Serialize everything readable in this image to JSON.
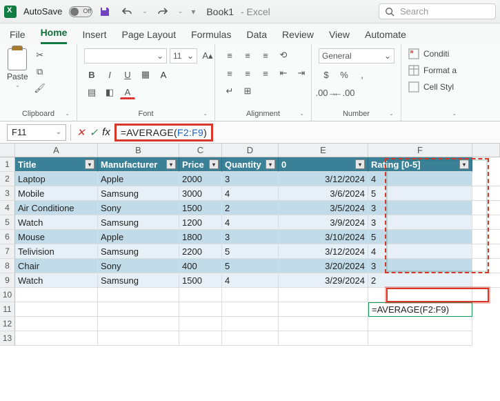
{
  "titlebar": {
    "autosave_label": "AutoSave",
    "autosave_state": "Off",
    "book_name": "Book1",
    "app_name": "Excel",
    "search_placeholder": "Search"
  },
  "tabs": [
    "File",
    "Home",
    "Insert",
    "Page Layout",
    "Formulas",
    "Data",
    "Review",
    "View",
    "Automate"
  ],
  "active_tab": "Home",
  "ribbon": {
    "clipboard": {
      "paste": "Paste",
      "group": "Clipboard"
    },
    "font": {
      "size": "11",
      "group": "Font"
    },
    "alignment": {
      "group": "Alignment"
    },
    "number": {
      "format": "General",
      "group": "Number"
    },
    "styles": {
      "cond": "Conditi",
      "fmt": "Format a",
      "cell": "Cell Styl"
    }
  },
  "namebox": "F11",
  "formula": {
    "prefix": "=AVERAGE(",
    "ref": "F2:F9",
    "suffix": ")"
  },
  "columns_letters": [
    "A",
    "B",
    "C",
    "D",
    "E",
    "F"
  ],
  "headers": [
    "Title",
    "Manufacturer",
    "Price",
    "Quantity",
    "0",
    "Rating [0-5]"
  ],
  "rows": [
    {
      "title": "Laptop",
      "mfr": "Apple",
      "price": "2000",
      "qty": "3",
      "date": "3/12/2024",
      "rating": "4"
    },
    {
      "title": "Mobile",
      "mfr": "Samsung",
      "price": "3000",
      "qty": "4",
      "date": "3/6/2024",
      "rating": "5"
    },
    {
      "title": "Air Conditione",
      "mfr": "Sony",
      "price": "1500",
      "qty": "2",
      "date": "3/5/2024",
      "rating": "3"
    },
    {
      "title": "Watch",
      "mfr": "Samsung",
      "price": "1200",
      "qty": "4",
      "date": "3/9/2024",
      "rating": "3"
    },
    {
      "title": "Mouse",
      "mfr": "Apple",
      "price": "1800",
      "qty": "3",
      "date": "3/10/2024",
      "rating": "5"
    },
    {
      "title": "Telivision",
      "mfr": "Samsung",
      "price": "2200",
      "qty": "5",
      "date": "3/12/2024",
      "rating": "4"
    },
    {
      "title": "Chair",
      "mfr": "Sony",
      "price": "400",
      "qty": "5",
      "date": "3/20/2024",
      "rating": "3"
    },
    {
      "title": "Watch",
      "mfr": "Samsung",
      "price": "1500",
      "qty": "4",
      "date": "3/29/2024",
      "rating": "2"
    }
  ],
  "result_cell": "=AVERAGE(F2:F9)",
  "chart_data": {
    "type": "table",
    "columns": [
      "Title",
      "Manufacturer",
      "Price",
      "Quantity",
      "0",
      "Rating [0-5]"
    ],
    "data": [
      [
        "Laptop",
        "Apple",
        2000,
        3,
        "3/12/2024",
        4
      ],
      [
        "Mobile",
        "Samsung",
        3000,
        4,
        "3/6/2024",
        5
      ],
      [
        "Air Conditioner",
        "Sony",
        1500,
        2,
        "3/5/2024",
        3
      ],
      [
        "Watch",
        "Samsung",
        1200,
        4,
        "3/9/2024",
        3
      ],
      [
        "Mouse",
        "Apple",
        1800,
        3,
        "3/10/2024",
        5
      ],
      [
        "Telivision",
        "Samsung",
        2200,
        5,
        "3/12/2024",
        4
      ],
      [
        "Chair",
        "Sony",
        400,
        5,
        "3/20/2024",
        3
      ],
      [
        "Watch",
        "Samsung",
        1500,
        4,
        "3/29/2024",
        2
      ]
    ],
    "formula_cell": {
      "ref": "F11",
      "formula": "=AVERAGE(F2:F9)"
    }
  }
}
